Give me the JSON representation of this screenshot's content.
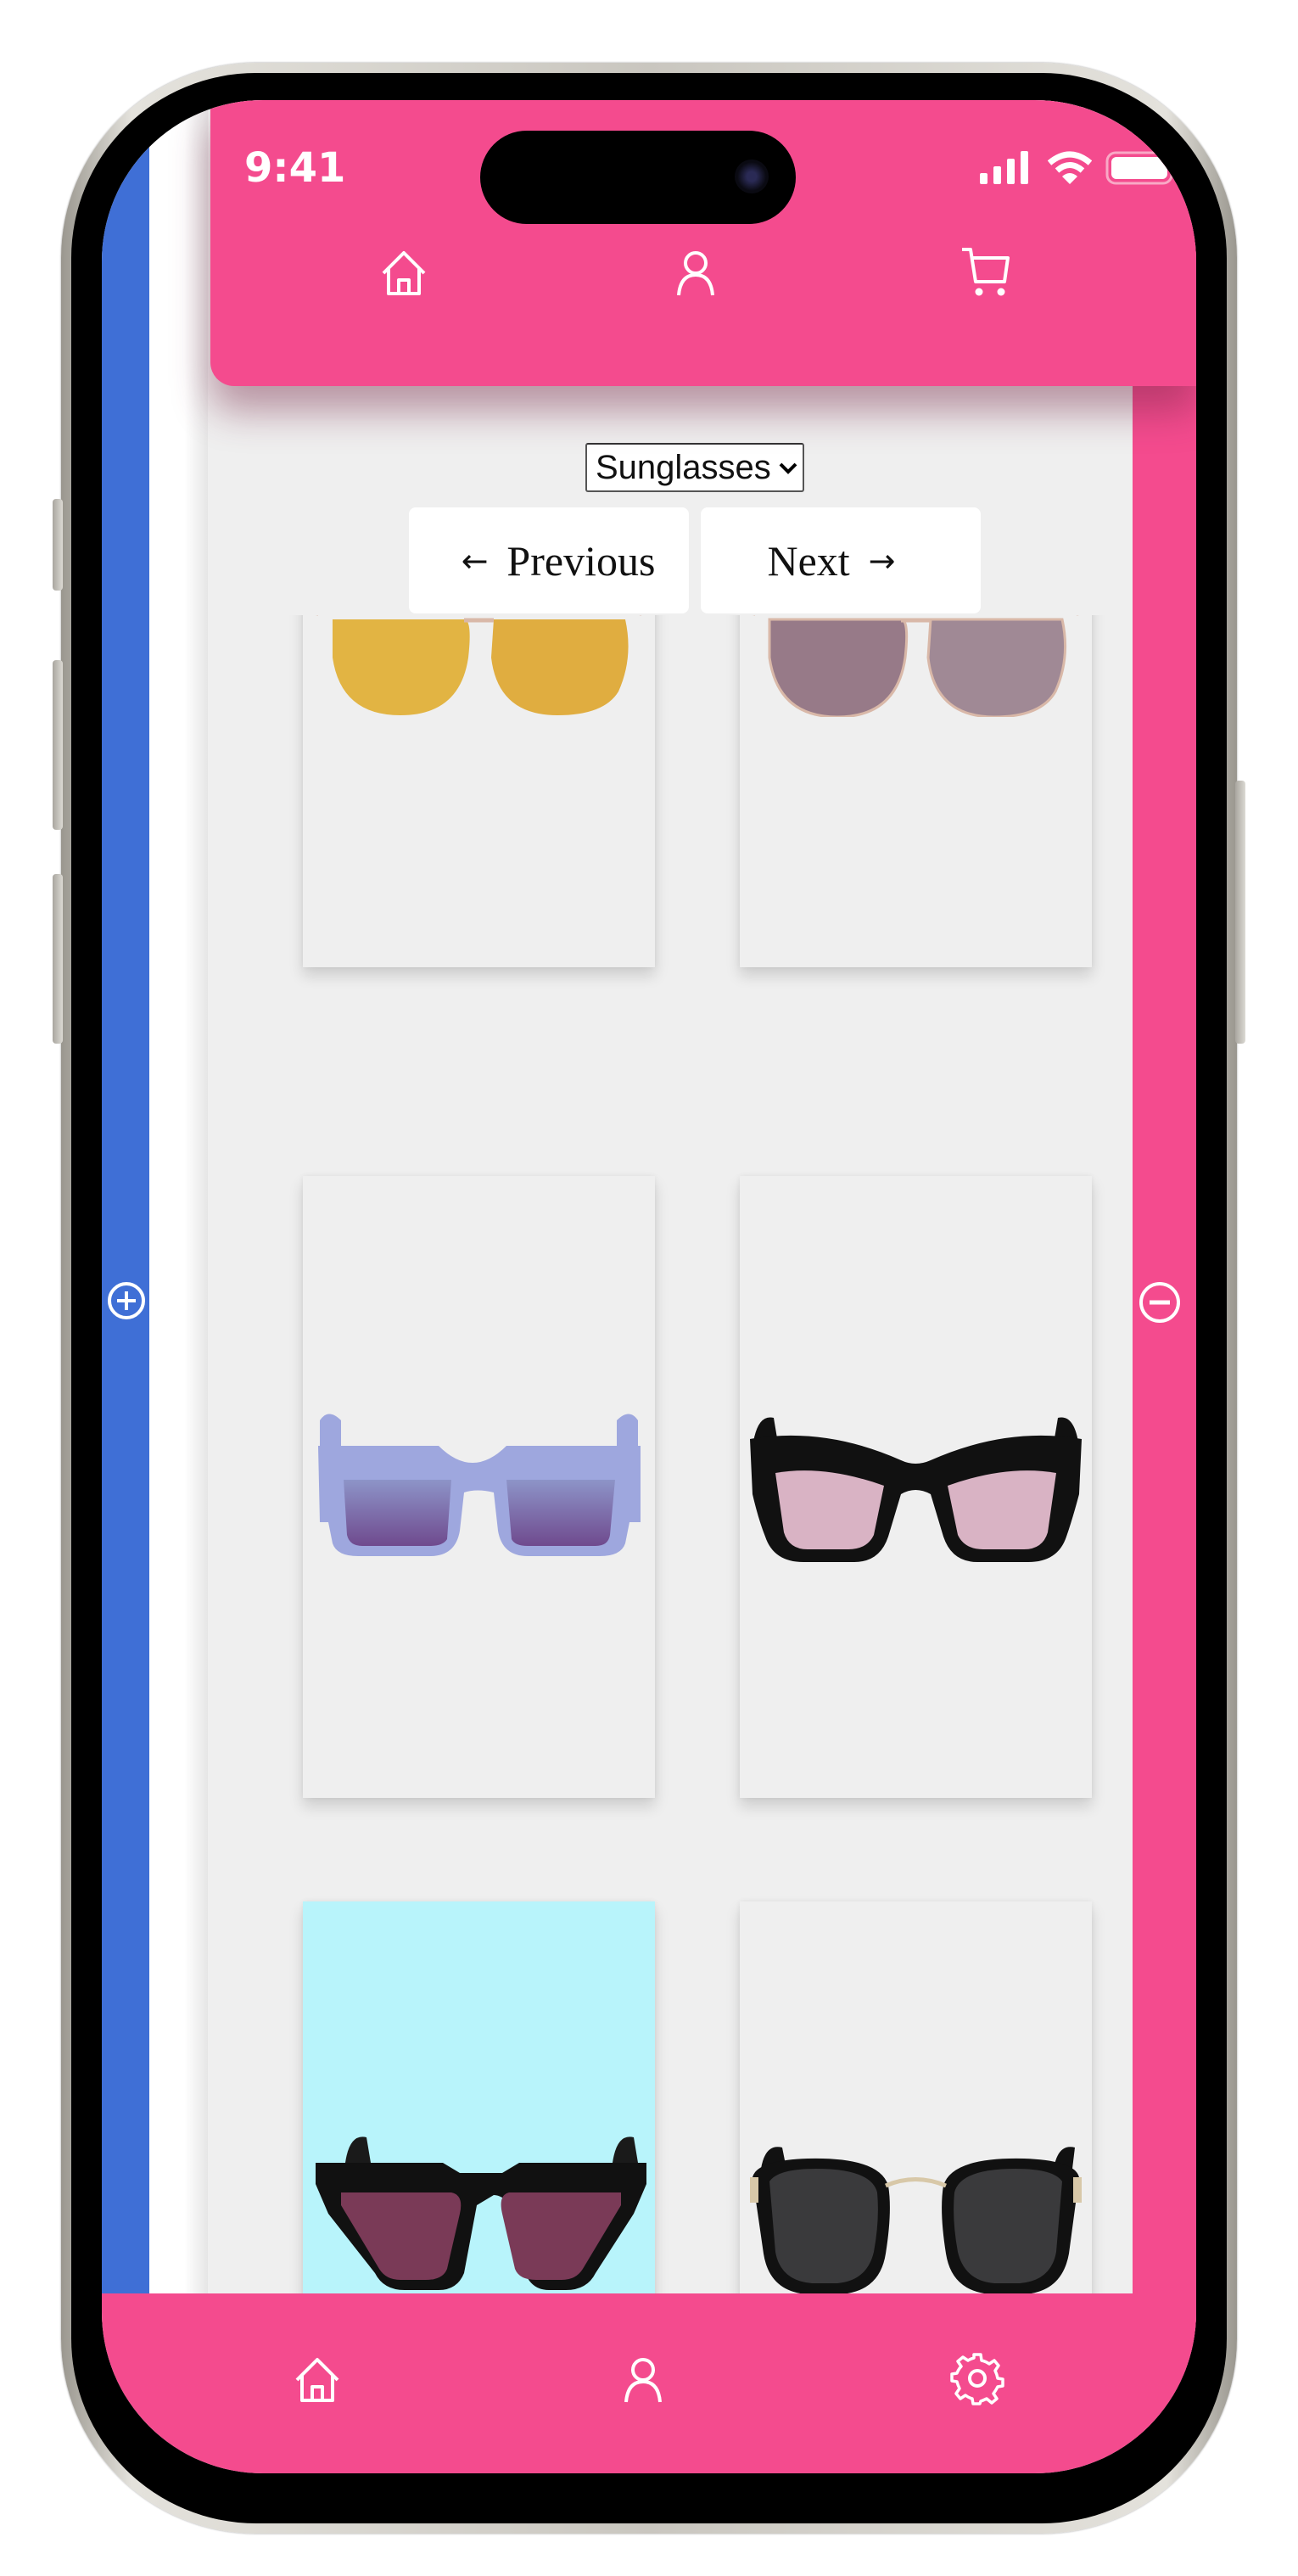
{
  "status_bar": {
    "time": "9:41",
    "icons": [
      "cellular-signal-icon",
      "wifi-icon",
      "battery-icon"
    ]
  },
  "top_nav": {
    "items": [
      {
        "icon": "home-icon",
        "label": "Home"
      },
      {
        "icon": "user-icon",
        "label": "Profile"
      },
      {
        "icon": "cart-icon",
        "label": "Cart"
      }
    ]
  },
  "category_select": {
    "selected": "Sunglasses",
    "chevron": "⌄"
  },
  "pager": {
    "previous_label": "Previous",
    "previous_arrow": "←",
    "next_label": "Next",
    "next_arrow": "→"
  },
  "side_controls": {
    "left": {
      "icon": "plus-circle-icon",
      "color": "#3f6fd6"
    },
    "right": {
      "icon": "minus-circle-icon",
      "color": "#f44b8e"
    }
  },
  "products": [
    {
      "style": "aviator",
      "lens_color": "#e2b443",
      "frame_color": "#d9b8a8",
      "background": "#efefef"
    },
    {
      "style": "aviator",
      "lens_color": "#9c7d8c",
      "frame_color": "#d9b8a8",
      "background": "#efefef"
    },
    {
      "style": "square",
      "lens_color": "#7b5fa0",
      "frame_color": "#9ea7de",
      "background": "#efefef"
    },
    {
      "style": "wayfarer",
      "lens_color": "#d9b3c4",
      "frame_color": "#111111",
      "background": "#efefef"
    },
    {
      "style": "cat-eye",
      "lens_color": "#7a3a57",
      "frame_color": "#111111",
      "background": "#b8f4fb"
    },
    {
      "style": "round-metal",
      "lens_color": "#3a3a3c",
      "frame_color": "#111111",
      "background": "#efefef"
    }
  ],
  "bottom_nav": {
    "items": [
      {
        "icon": "home-icon",
        "label": "Home"
      },
      {
        "icon": "user-icon",
        "label": "Profile"
      },
      {
        "icon": "gear-icon",
        "label": "Settings"
      }
    ]
  },
  "colors": {
    "accent_pink": "#f44b8e",
    "accent_blue": "#3f6fd6",
    "content_bg": "#efefef"
  }
}
